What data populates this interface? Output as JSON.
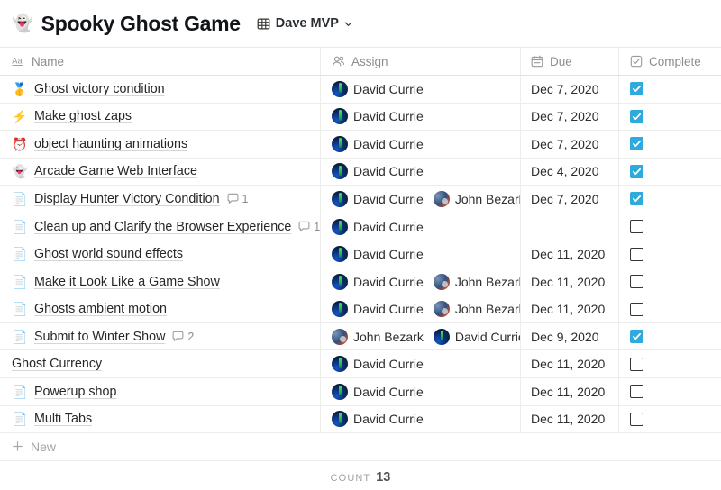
{
  "header": {
    "page_emoji": "👻",
    "page_emoji_name": "ghost-emoji",
    "title": "Spooky Ghost Game",
    "view": {
      "icon": "table-grid-icon",
      "label": "Dave MVP",
      "chevron": "chevron-down-icon"
    }
  },
  "table": {
    "columns": [
      {
        "key": "name",
        "label": "Name",
        "icon": "text-aa-icon"
      },
      {
        "key": "assign",
        "label": "Assign",
        "icon": "person-icon"
      },
      {
        "key": "due",
        "label": "Due",
        "icon": "calendar-icon"
      },
      {
        "key": "complete",
        "label": "Complete",
        "icon": "checkbox-icon"
      }
    ],
    "rows": [
      {
        "icon": "🥇",
        "icon_name": "medal-emoji",
        "title": "Ghost victory condition",
        "comments": null,
        "assignees": [
          "David Currie"
        ],
        "due": "Dec 7, 2020",
        "complete": true
      },
      {
        "icon": "⚡",
        "icon_name": "lightning-emoji",
        "title": "Make ghost zaps",
        "comments": null,
        "assignees": [
          "David Currie"
        ],
        "due": "Dec 7, 2020",
        "complete": true
      },
      {
        "icon": "⏰",
        "icon_name": "alarm-clock-emoji",
        "title": "object haunting animations",
        "comments": null,
        "assignees": [
          "David Currie"
        ],
        "due": "Dec 7, 2020",
        "complete": true
      },
      {
        "icon": "👻",
        "icon_name": "ghost-emoji",
        "title": "Arcade Game Web Interface",
        "comments": null,
        "assignees": [
          "David Currie"
        ],
        "due": "Dec 4, 2020",
        "complete": true
      },
      {
        "icon": "📄",
        "icon_name": "page-icon",
        "title": "Display Hunter Victory Condition",
        "comments": "1",
        "assignees": [
          "David Currie",
          "John Bezark"
        ],
        "due": "Dec 7, 2020",
        "complete": true
      },
      {
        "icon": "📄",
        "icon_name": "page-icon",
        "title": "Clean up and Clarify the Browser Experience",
        "comments": "1",
        "assignees": [
          "David Currie"
        ],
        "due": "",
        "complete": false
      },
      {
        "icon": "📄",
        "icon_name": "page-icon",
        "title": "Ghost world sound effects",
        "comments": null,
        "assignees": [
          "David Currie"
        ],
        "due": "Dec 11, 2020",
        "complete": false
      },
      {
        "icon": "📄",
        "icon_name": "page-icon",
        "title": "Make it Look Like a Game Show",
        "comments": null,
        "assignees": [
          "David Currie",
          "John Bezark"
        ],
        "due": "Dec 11, 2020",
        "complete": false
      },
      {
        "icon": "📄",
        "icon_name": "page-icon",
        "title": "Ghosts ambient motion",
        "comments": null,
        "assignees": [
          "David Currie",
          "John Bezark"
        ],
        "due": "Dec 11, 2020",
        "complete": false
      },
      {
        "icon": "📄",
        "icon_name": "page-icon",
        "title": "Submit to Winter Show",
        "comments": "2",
        "assignees": [
          "John Bezark",
          "David Currie"
        ],
        "due": "Dec 9, 2020",
        "complete": true
      },
      {
        "icon": "",
        "icon_name": "no-icon",
        "title": "Ghost Currency",
        "comments": null,
        "assignees": [
          "David Currie"
        ],
        "due": "Dec 11, 2020",
        "complete": false
      },
      {
        "icon": "📄",
        "icon_name": "page-icon",
        "title": "Powerup shop",
        "comments": null,
        "assignees": [
          "David Currie"
        ],
        "due": "Dec 11, 2020",
        "complete": false
      },
      {
        "icon": "📄",
        "icon_name": "page-icon",
        "title": "Multi Tabs",
        "comments": null,
        "assignees": [
          "David Currie"
        ],
        "due": "Dec 11, 2020",
        "complete": false
      }
    ]
  },
  "new_row": {
    "label": "New",
    "icon": "plus-icon"
  },
  "footer": {
    "count_label": "Count",
    "count_value": "13"
  },
  "colors": {
    "checkbox_checked": "#2eaadc",
    "text_primary": "#252628",
    "text_muted": "#8d8c89",
    "border": "#ececeb"
  }
}
